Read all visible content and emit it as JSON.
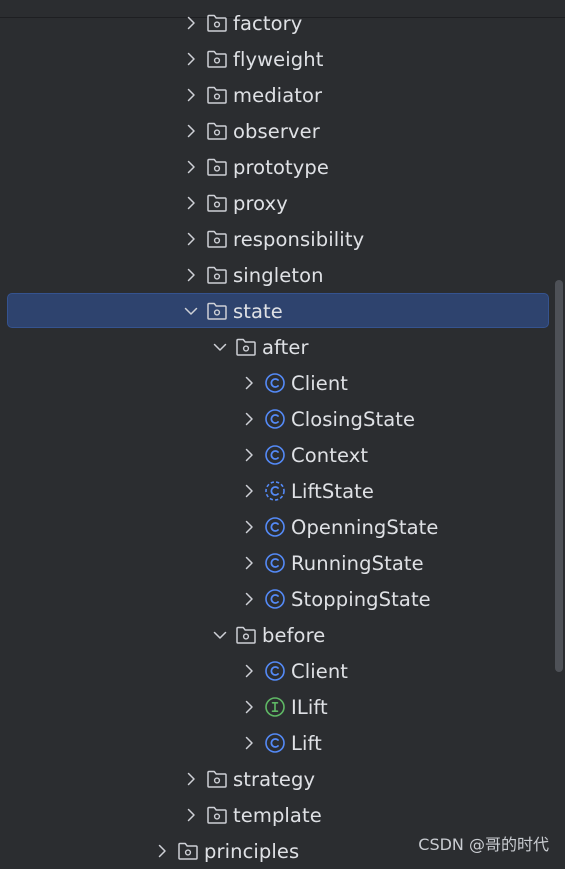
{
  "project_tree": {
    "rows": [
      {
        "label": "factory",
        "icon": "package-folder-icon",
        "level": 1,
        "expanded": false
      },
      {
        "label": "flyweight",
        "icon": "package-folder-icon",
        "level": 1,
        "expanded": false
      },
      {
        "label": "mediator",
        "icon": "package-folder-icon",
        "level": 1,
        "expanded": false
      },
      {
        "label": "observer",
        "icon": "package-folder-icon",
        "level": 1,
        "expanded": false
      },
      {
        "label": "prototype",
        "icon": "package-folder-icon",
        "level": 1,
        "expanded": false
      },
      {
        "label": "proxy",
        "icon": "package-folder-icon",
        "level": 1,
        "expanded": false
      },
      {
        "label": "responsibility",
        "icon": "package-folder-icon",
        "level": 1,
        "expanded": false
      },
      {
        "label": "singleton",
        "icon": "package-folder-icon",
        "level": 1,
        "expanded": false
      },
      {
        "label": "state",
        "icon": "package-folder-icon",
        "level": 1,
        "expanded": true,
        "selected": true
      },
      {
        "label": "after",
        "icon": "package-folder-icon",
        "level": 2,
        "expanded": true
      },
      {
        "label": "Client",
        "icon": "class-icon",
        "level": 3,
        "expanded": false
      },
      {
        "label": "ClosingState",
        "icon": "class-icon",
        "level": 3,
        "expanded": false
      },
      {
        "label": "Context",
        "icon": "class-icon",
        "level": 3,
        "expanded": false
      },
      {
        "label": "LiftState",
        "icon": "abstract-class-icon",
        "level": 3,
        "expanded": false
      },
      {
        "label": "OpenningState",
        "icon": "class-icon",
        "level": 3,
        "expanded": false
      },
      {
        "label": "RunningState",
        "icon": "class-icon",
        "level": 3,
        "expanded": false
      },
      {
        "label": "StoppingState",
        "icon": "class-icon",
        "level": 3,
        "expanded": false
      },
      {
        "label": "before",
        "icon": "package-folder-icon",
        "level": 2,
        "expanded": true
      },
      {
        "label": "Client",
        "icon": "class-icon",
        "level": 3,
        "expanded": false
      },
      {
        "label": "ILift",
        "icon": "interface-icon",
        "level": 3,
        "expanded": false
      },
      {
        "label": "Lift",
        "icon": "class-icon",
        "level": 3,
        "expanded": false
      },
      {
        "label": "strategy",
        "icon": "package-folder-icon",
        "level": 1,
        "expanded": false
      },
      {
        "label": "template",
        "icon": "package-folder-icon",
        "level": 1,
        "expanded": false
      },
      {
        "label": "principles",
        "icon": "package-folder-icon",
        "level": 0,
        "expanded": false
      }
    ]
  },
  "colors": {
    "background": "#2b2d30",
    "selection": "#2e436e",
    "text": "#dfe1e5",
    "class_icon": "#548af7",
    "interface_icon": "#5fb865",
    "folder_icon": "#ced0d6"
  },
  "watermark": "CSDN @哥的时代"
}
